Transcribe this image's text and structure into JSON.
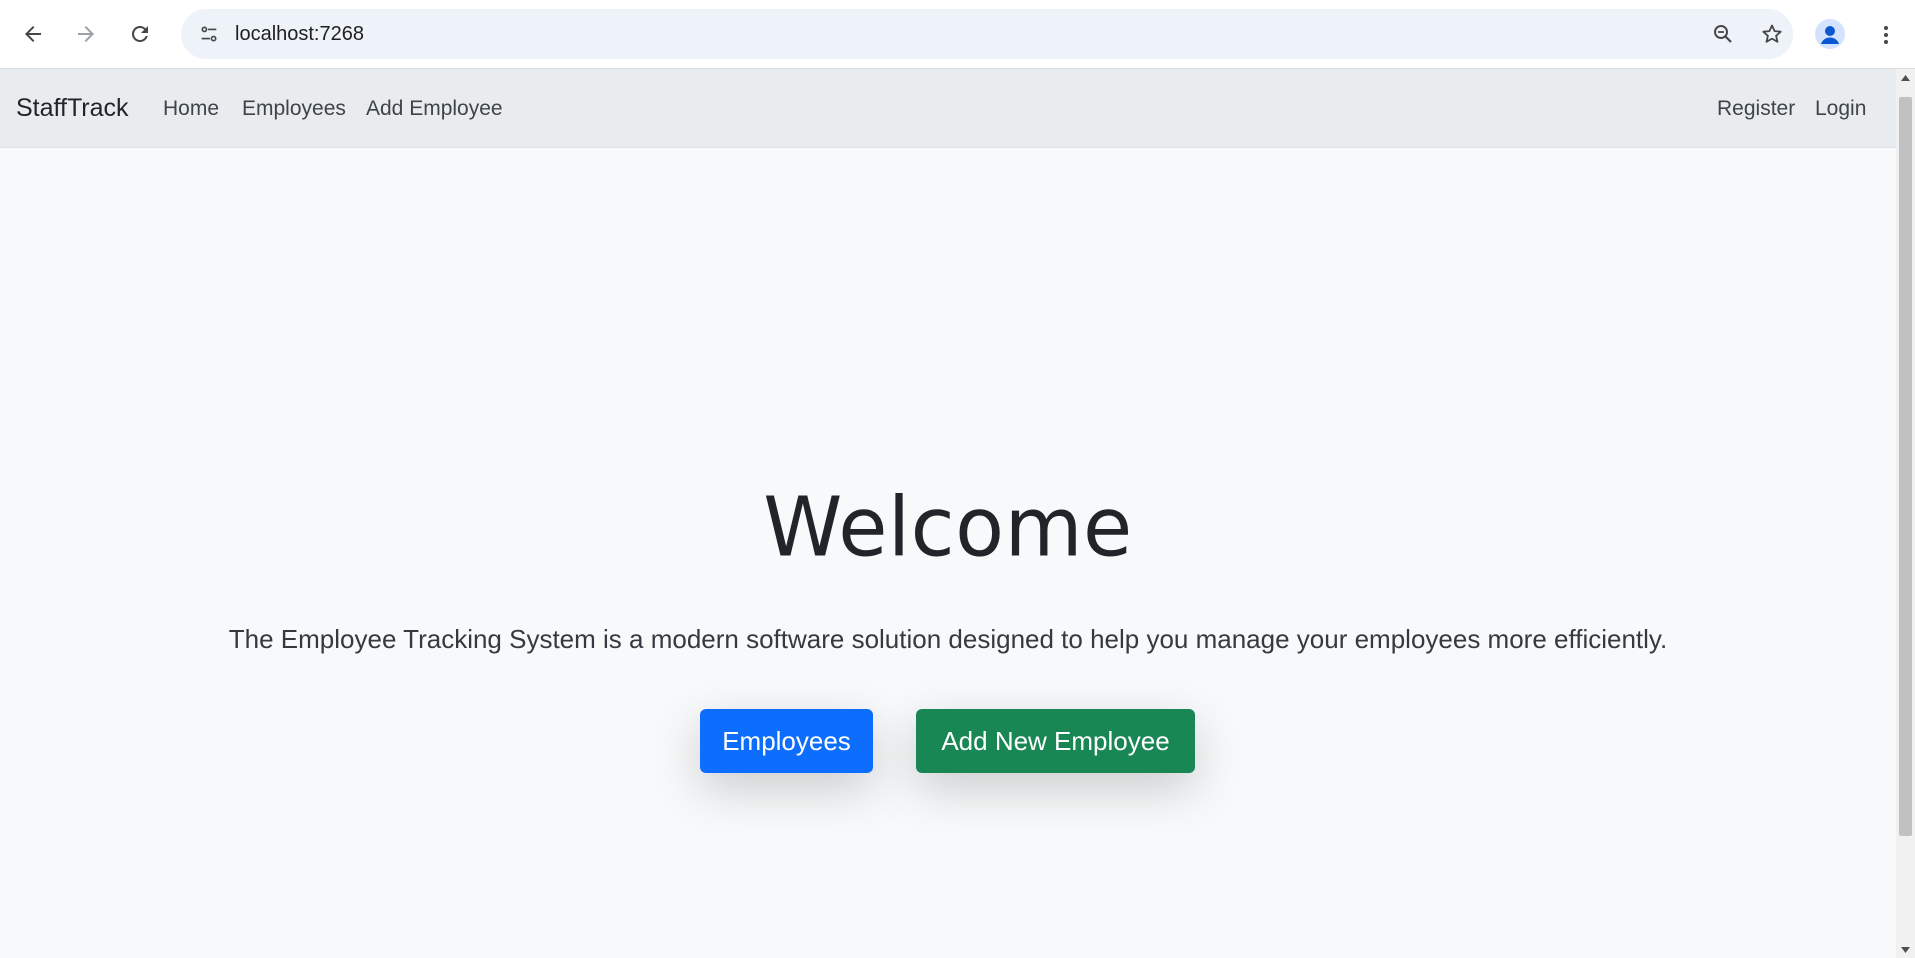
{
  "browser": {
    "url": "localhost:7268",
    "icons": {
      "back": "arrow-left-icon",
      "forward": "arrow-right-icon",
      "reload": "reload-icon",
      "site_info": "tune-icon",
      "zoom": "zoom-out-icon",
      "bookmark": "star-icon",
      "profile": "account-icon",
      "menu": "more-vert-icon"
    }
  },
  "navbar": {
    "brand": "StaffTrack",
    "links": [
      "Home",
      "Employees",
      "Add Employee"
    ],
    "right_links": [
      "Register",
      "Login"
    ]
  },
  "hero": {
    "title": "Welcome",
    "lead": "The Employee Tracking System is a modern software solution designed to help you manage your employees more efficiently.",
    "buttons": {
      "employees": "Employees",
      "add_employee": "Add New Employee"
    }
  },
  "colors": {
    "primary": "#0d6efd",
    "success": "#198754",
    "navbar_bg": "#e9ecef",
    "page_bg": "#f8f9fa"
  }
}
